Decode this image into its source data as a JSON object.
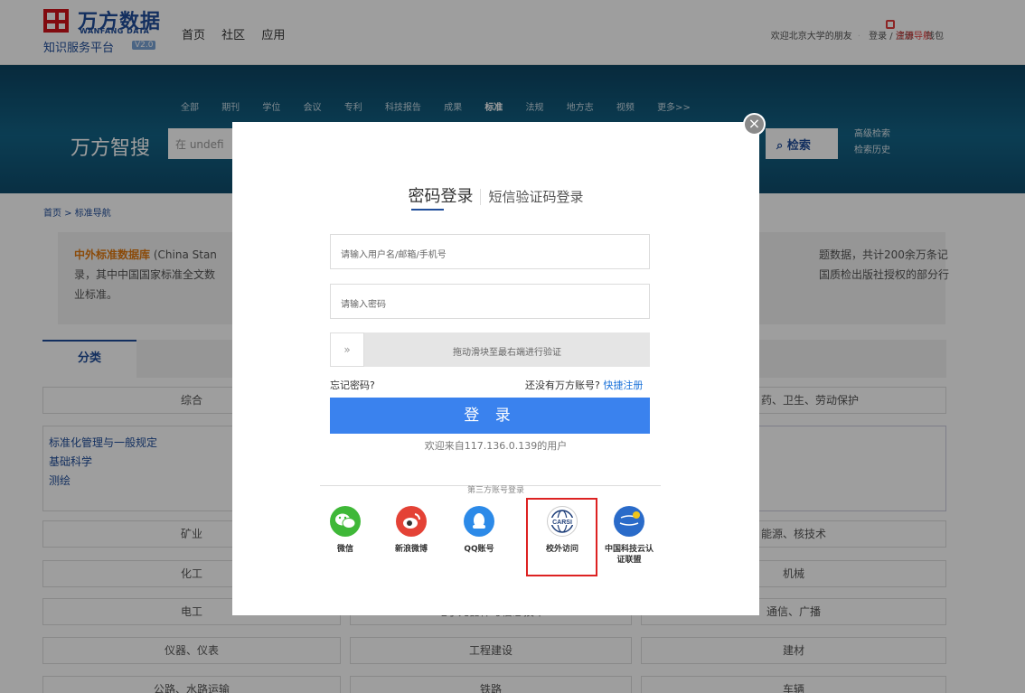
{
  "header": {
    "brand_cn": "万方数据",
    "brand_en": "WANFANG DATA",
    "brand_sub": "知识服务平台",
    "version": "V2.0",
    "nav": [
      "首页",
      "社区",
      "应用"
    ],
    "welcome": "欢迎北京大学的朋友",
    "login_register": "登录 / 注册",
    "wallet": "钱包",
    "resource_nav": "资源导航"
  },
  "search": {
    "types": [
      "全部",
      "期刊",
      "学位",
      "会议",
      "专利",
      "科技报告",
      "成果",
      "标准",
      "法规",
      "地方志",
      "视频",
      "更多>>"
    ],
    "active_type": "标准",
    "brand": "万方智搜",
    "placeholder": "在 undefi",
    "button": "检索",
    "advanced": "高级检索",
    "history": "检索历史"
  },
  "content": {
    "breadcrumb": "首页 > 标准导航",
    "intro_title": "中外标准数据库",
    "intro_left_1": "(China Stan",
    "intro_left_2": "录，其中中国国家标准全文数",
    "intro_left_3": "业标准。",
    "intro_right_1": "题数据，共计200余万条记",
    "intro_right_2": "国质检出版社授权的部分行",
    "tab_classify": "分类",
    "categories": {
      "general": "综合",
      "medicine": "药、卫生、劳动保护",
      "mining": "矿业",
      "energy": "能源、核技术",
      "chemical": "化工",
      "machinery": "机械",
      "electrical": "电工",
      "electronics": "电子元器件与信息技术",
      "telecom": "通信、广播",
      "instruments": "仪器、仪表",
      "construction": "工程建设",
      "building": "建材",
      "highway": "公路、水路运输",
      "railway": "铁路",
      "vehicle": "车辆"
    },
    "subgroup": [
      "标准化管理与一般规定",
      "基础科学",
      "测绘"
    ]
  },
  "login_modal": {
    "tab_password": "密码登录",
    "tab_sms": "短信验证码登录",
    "username_placeholder": "请输入用户名/邮箱/手机号",
    "password_placeholder": "请输入密码",
    "slider_text": "拖动滑块至最右端进行验证",
    "slider_arrow": "»",
    "forgot": "忘记密码?",
    "no_account": "还没有万方账号?",
    "quick_register": "快捷注册",
    "login_button": "登 录",
    "welcome_ip": "欢迎来自117.136.0.139的用户",
    "third_party": "第三方账号登录",
    "sso": [
      {
        "label": "微信",
        "color": "#3fb838"
      },
      {
        "label": "新浪微博",
        "color": "#e44236"
      },
      {
        "label": "QQ账号",
        "color": "#2c8ae8"
      },
      {
        "label": "校外访问",
        "color": "#ffffff"
      },
      {
        "label": "中国科技云认证联盟",
        "color": "#2a6bc9"
      }
    ],
    "carsi_text": "CARSI"
  }
}
